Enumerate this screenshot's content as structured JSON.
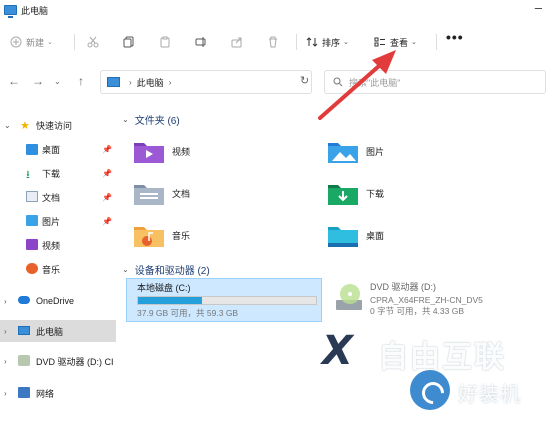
{
  "window": {
    "title": "此电脑"
  },
  "toolbar": {
    "new_label": "新建",
    "sort_label": "排序",
    "view_label": "查看",
    "more_label": "•••"
  },
  "address": {
    "location": "此电脑",
    "search_placeholder": "搜索\"此电脑\""
  },
  "sidebar": {
    "quick_access": "快速访问",
    "quick_items": [
      "桌面",
      "下载",
      "文档",
      "图片",
      "视频",
      "音乐"
    ],
    "onedrive": "OneDrive",
    "this_pc": "此电脑",
    "dvd": "DVD 驱动器 (D:) CI",
    "network": "网络"
  },
  "folders": {
    "header": "文件夹 (6)",
    "items": [
      "视频",
      "图片",
      "文档",
      "下载",
      "音乐",
      "桌面"
    ]
  },
  "drives": {
    "header": "设备和驱动器 (2)",
    "local": {
      "name": "本地磁盘 (C:)",
      "detail": "37.9 GB 可用，共 59.3 GB",
      "used_fraction": 0.36
    },
    "dvd": {
      "name": "DVD 驱动器 (D:)",
      "label": "CPRA_X64FRE_ZH-CN_DV5",
      "detail": "0 字节 可用，共 4.33 GB"
    }
  },
  "watermark": {
    "big": "自由互联",
    "small": "好装机"
  },
  "colors": {
    "accent": "#1f6fb8",
    "selected_bg": "#cde8ff",
    "arrow": "#e23b3b"
  }
}
